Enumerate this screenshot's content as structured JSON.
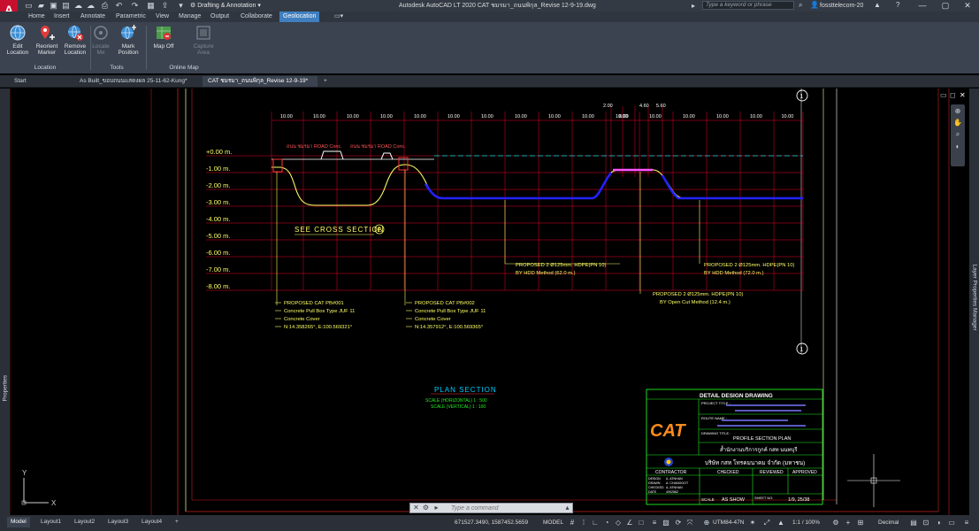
{
  "app": {
    "logo_letter": "A",
    "logo_sub": "LT",
    "title": "Autodesk AutoCAD LT 2020   CAT ชมรมา_ถนนพิกุล_Revise 12-9-19.dwg",
    "workspace": "Drafting & Annotation",
    "search_placeholder": "Type a keyword or phrase",
    "user": "fossttelecom-20",
    "icons": [
      "new-icon",
      "open-icon",
      "save-icon",
      "save-as-icon",
      "cloud-open-icon",
      "cloud-save-icon",
      "print-icon",
      "undo-icon",
      "redo-icon",
      "share-icon"
    ]
  },
  "ribbon_tabs": [
    "Home",
    "Insert",
    "Annotate",
    "Parametric",
    "View",
    "Manage",
    "Output",
    "Collaborate",
    "Geolocation"
  ],
  "ribbon_active_tab": "Geolocation",
  "ribbon": {
    "buttons": [
      {
        "label": "Edit Location",
        "l1": "Edit",
        "l2": "Location",
        "enabled": true
      },
      {
        "label": "Reorient Marker",
        "l1": "Reorient",
        "l2": "Marker",
        "enabled": true
      },
      {
        "label": "Remove Location",
        "l1": "Remove",
        "l2": "Location",
        "enabled": true
      },
      {
        "label": "Locate Me",
        "l1": "Locate",
        "l2": "Me",
        "enabled": false
      },
      {
        "label": "Mark Position",
        "l1": "Mark",
        "l2": "Position",
        "enabled": true
      },
      {
        "label": "Map Off",
        "l1": "Map Off",
        "l2": "",
        "enabled": true
      },
      {
        "label": "Capture Area",
        "l1": "Capture",
        "l2": "Area",
        "enabled": false
      }
    ],
    "panels": [
      "Location",
      "Tools",
      "Online Map"
    ]
  },
  "file_tabs": [
    {
      "label": "Start",
      "active": false
    },
    {
      "label": "As Built_ขอบถนนแสดงผล 25-11-62-Kung*",
      "active": false
    },
    {
      "label": "CAT ชมรมา_ถนนพิกุล_Revise 12-9-19*",
      "active": true
    }
  ],
  "left_palette": "Properties",
  "right_palette": "Layer Properties Manager",
  "drawing": {
    "colors": {
      "grid_red": "#e8002a",
      "yellow": "#ffff66",
      "blue": "#1a1aff",
      "cyan": "#00e5e5",
      "green": "#22ee22",
      "magenta": "#ff55ff",
      "white": "#f0f0f0"
    },
    "depth_labels": [
      "+0.00  m.",
      "-1.00  m.",
      "-2.00  m.",
      "-3.00  m.",
      "-4.00  m.",
      "-5.00  m.",
      "-6.00  m.",
      "-7.00  m.",
      "-8.00  m."
    ],
    "spacing_labels": [
      "10.00",
      "10.00",
      "10.00",
      "10.00",
      "10.00",
      "10.00",
      "10.00",
      "10.00",
      "10.00",
      "10.00",
      "10.00",
      "10.00",
      "10.00",
      "10.00",
      "10.00",
      "10.00"
    ],
    "spacing_extra": [
      "2.00",
      "8.00",
      "4.60",
      "5.60"
    ],
    "road_labels": [
      "ถนน ชมรมา ROAD Conc.",
      "ถนน ชมรมา ROAD Conc."
    ],
    "see_section": "SEE  CROSS  SECTION",
    "see_section_mark": "E",
    "notes_pb1": [
      "PROPOSED CAT PB#001",
      "Concrete Pull Box Type JUF 11",
      "Concrete Cover",
      "N:14.358265°, E:100.569321°"
    ],
    "notes_pb2": [
      "PROPOSED CAT PB#002",
      "Concrete Pull Box Type JUF 11",
      "Concrete Cover",
      "N:14.357912°, E:100.569365°"
    ],
    "notes_hdd1": [
      "PROPOSED 2  Ø125mm. HDPE(PN 10)",
      "BY HDD  Method (62.0 m.)"
    ],
    "notes_hdd2": [
      "PROPOSED 2  Ø125mm. HDPE(PN 10)",
      "BY HDD  Method (72.0 m.)"
    ],
    "notes_open": [
      "PROPOSED 2  Ø125mm. HDPE(PN 10)",
      "BY Open Cut Method (12.4 m.)"
    ],
    "plan_title": "PLAN   SECTION",
    "plan_scale_h": "SCALE (HORIZONTAL)   1 : 500",
    "plan_scale_v": "SCALE (VERTICAL)   1 : 100",
    "title_block": {
      "header": "DETAIL DESIGN DRAWING",
      "project_title_label": "PROJECT TITLE :",
      "route_name_label": "ROUTE NAME :",
      "drawing_title_label": "DRAWING TITLE :",
      "drawing_title": "PROFILE SECTION PLAN",
      "logo": "CAT",
      "owner_th": "ส้ำนักงานบริการกูกค์ กสท นนทบุรี",
      "company_th": "บริษัท กสท โทรคมนาคม จำกัด (มหาชน)",
      "cols": [
        "CONTRACTOR",
        "CHECKED",
        "REVIEWED",
        "APPROVED"
      ],
      "rows": [
        [
          "DESIGN",
          "A. ATNHAN"
        ],
        [
          "DRAWN",
          "A. CHANGGOT"
        ],
        [
          "CHECKED",
          "A. ATNHAN"
        ],
        [
          "DATE",
          "4/9/2562"
        ]
      ],
      "scale_label": "SCALE",
      "scale_value": "AS SHOW",
      "sheet_label": "SHEET NO.",
      "sheet_value": "1/9, 25/38",
      "callouts": [
        "1",
        "1"
      ]
    }
  },
  "layout_tabs": [
    {
      "label": "Model",
      "active": true
    },
    {
      "label": "Layout1",
      "active": false
    },
    {
      "label": "Layout2",
      "active": false
    },
    {
      "label": "Layout3",
      "active": false
    },
    {
      "label": "Layout4",
      "active": false
    }
  ],
  "command_placeholder": "Type a command",
  "status": {
    "coords": "671527.3490, 1587452.5659",
    "mode": "MODEL",
    "coord_system": "UTM84-47N",
    "scale": "1:1 / 100%",
    "units": "Decimal"
  },
  "ucs": {
    "x": "X",
    "y": "Y"
  }
}
